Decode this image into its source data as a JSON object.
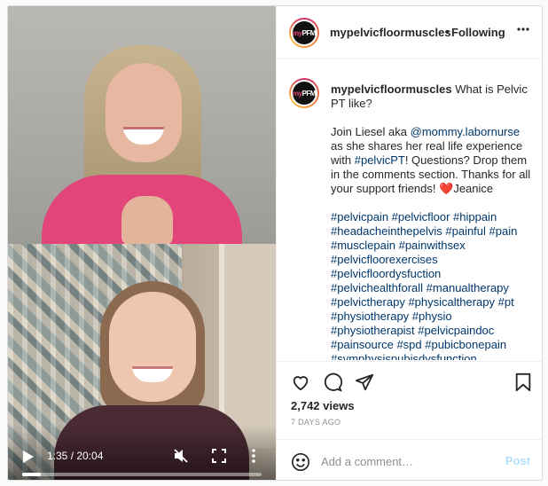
{
  "account": {
    "username": "mypelvicfloormuscles",
    "follow_separator": "•",
    "follow_status": "Following",
    "avatar_text_a": "my",
    "avatar_text_b": "PFM"
  },
  "post": {
    "caption_lead": "What is Pelvic PT like?",
    "body_line1_pre": "Join Liesel aka ",
    "body_mention": "@mommy.labornurse",
    "body_line1_post": " as she shares her real life experience with ",
    "body_hashtag": "#pelvicPT",
    "body_line2": "! Questions? Drop them in the comments section. Thanks for all your support friends! ",
    "body_heart": "❤️",
    "body_signoff": "Jeanice",
    "hashtags": "#pelvicpain #pelvicfloor #hippain #headacheinthepelvis #painful #pain #musclepain #painwithsex #pelvicfloorexercises #pelvicfloordysfuction #pelvichealthforall #manualtherapy #pelvictherapy #physicaltherapy #pt #physiotherapy #physio #physiotherapist #pelvicpaindoc #painsource #spd #pubicbonepain #symphysispubisdysfunction"
  },
  "video": {
    "current_time": "1:35",
    "duration": "20:04",
    "time_separator": " / ",
    "progress": 0.079,
    "muted": true
  },
  "stats": {
    "views": "2,742 views",
    "posted_ago": "7 DAYS AGO"
  },
  "comment_box": {
    "placeholder": "Add a comment…",
    "post_label": "Post"
  },
  "icons": {
    "like": "heart-icon",
    "comment": "speech-bubble-icon",
    "share": "paper-plane-icon",
    "save": "bookmark-icon",
    "emoji": "smiley-icon",
    "options": "ellipsis-icon",
    "play": "play-icon",
    "mute": "speaker-muted-icon",
    "fullscreen": "fullscreen-icon",
    "video_more": "vertical-ellipsis-icon"
  },
  "colors": {
    "link": "#00376b",
    "post_disabled": "#b2dffc",
    "heart": "#e0245e"
  }
}
